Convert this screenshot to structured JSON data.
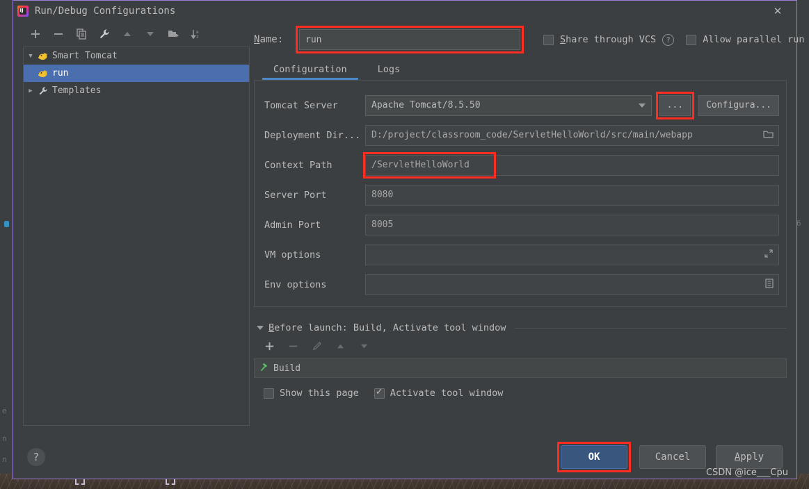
{
  "window": {
    "title": "Run/Debug Configurations",
    "app_icon": "intellij-idea-icon",
    "close_label": "✕"
  },
  "sidebar": {
    "toolbar": [
      {
        "name": "add-configuration-button",
        "glyph": "+"
      },
      {
        "name": "remove-configuration-button",
        "glyph": "−"
      },
      {
        "name": "copy-configuration-button",
        "glyph": "copy-icon"
      },
      {
        "name": "edit-templates-button",
        "glyph": "wrench-icon"
      },
      {
        "name": "move-up-button",
        "glyph": "▲"
      },
      {
        "name": "move-down-button",
        "glyph": "▼"
      },
      {
        "name": "create-folder-button",
        "glyph": "folder-plus-icon"
      },
      {
        "name": "sort-configurations-button",
        "glyph": "sort-az-icon"
      }
    ],
    "tree": [
      {
        "label": "Smart Tomcat",
        "icon": "tomcat-icon",
        "expanded": true,
        "selected": false,
        "twisty": "▼"
      },
      {
        "label": "run",
        "icon": "tomcat-icon",
        "expanded": false,
        "selected": true,
        "twisty": ""
      },
      {
        "label": "Templates",
        "icon": "wrench-icon",
        "expanded": false,
        "selected": false,
        "twisty": "▶"
      }
    ]
  },
  "name_row": {
    "label_prefix": "N",
    "label_rest": "ame:",
    "value": "run",
    "placeholder": "",
    "share_checkbox": {
      "label_prefix": "S",
      "label_rest": "hare through VCS",
      "checked": false
    },
    "help_glyph": "?",
    "parallel_checkbox": {
      "label": "Allow parallel run",
      "checked": false
    }
  },
  "tabs": [
    {
      "label": "Configuration",
      "active": true
    },
    {
      "label": "Logs",
      "active": false
    }
  ],
  "form": {
    "tomcat_server": {
      "label": "Tomcat Server",
      "value": "Apache Tomcat/8.5.50",
      "browse_button": "...",
      "configure_button": "Configura..."
    },
    "deployment_dir": {
      "label": "Deployment Dir...",
      "value": "D:/project/classroom_code/ServletHelloWorld/src/main/webapp",
      "icon": "folder-icon"
    },
    "context_path": {
      "label": "Context Path",
      "value": "/ServletHelloWorld"
    },
    "server_port": {
      "label": "Server Port",
      "value": "8080"
    },
    "admin_port": {
      "label": "Admin Port",
      "value": "8005"
    },
    "vm_options": {
      "label": "VM options",
      "value": "",
      "icon": "expand-icon"
    },
    "env_options": {
      "label": "Env options",
      "value": "",
      "icon": "list-icon"
    }
  },
  "before_launch": {
    "title_prefix": "B",
    "title_rest": "efore launch: Build, Activate tool window",
    "toolbar": [
      {
        "name": "add-task-button",
        "glyph": "+",
        "enabled": true
      },
      {
        "name": "remove-task-button",
        "glyph": "−",
        "enabled": false
      },
      {
        "name": "edit-task-button",
        "glyph": "pencil-icon",
        "enabled": false
      },
      {
        "name": "move-task-up-button",
        "glyph": "▲",
        "enabled": false
      },
      {
        "name": "move-task-down-button",
        "glyph": "▼",
        "enabled": false
      }
    ],
    "tasks": [
      {
        "label": "Build",
        "icon": "build-hammer-icon"
      }
    ],
    "show_page_checkbox": {
      "label": "Show this page",
      "checked": false
    },
    "activate_tool_window_checkbox": {
      "label": "Activate tool window",
      "checked": true
    }
  },
  "footer": {
    "help_glyph": "?",
    "ok_button": "OK",
    "cancel_button": "Cancel",
    "apply_prefix": "A",
    "apply_rest": "pply"
  },
  "watermark": "CSDN @ice___Cpu",
  "colors": {
    "accent_blue": "#4b6eaf",
    "tab_underline": "#4a88c7",
    "annotation_red": "#ff2d21",
    "dialog_border": "#9b7bd4",
    "panel_bg": "#3c3f41",
    "field_bg": "#45494a",
    "text": "#bbbbbb"
  }
}
